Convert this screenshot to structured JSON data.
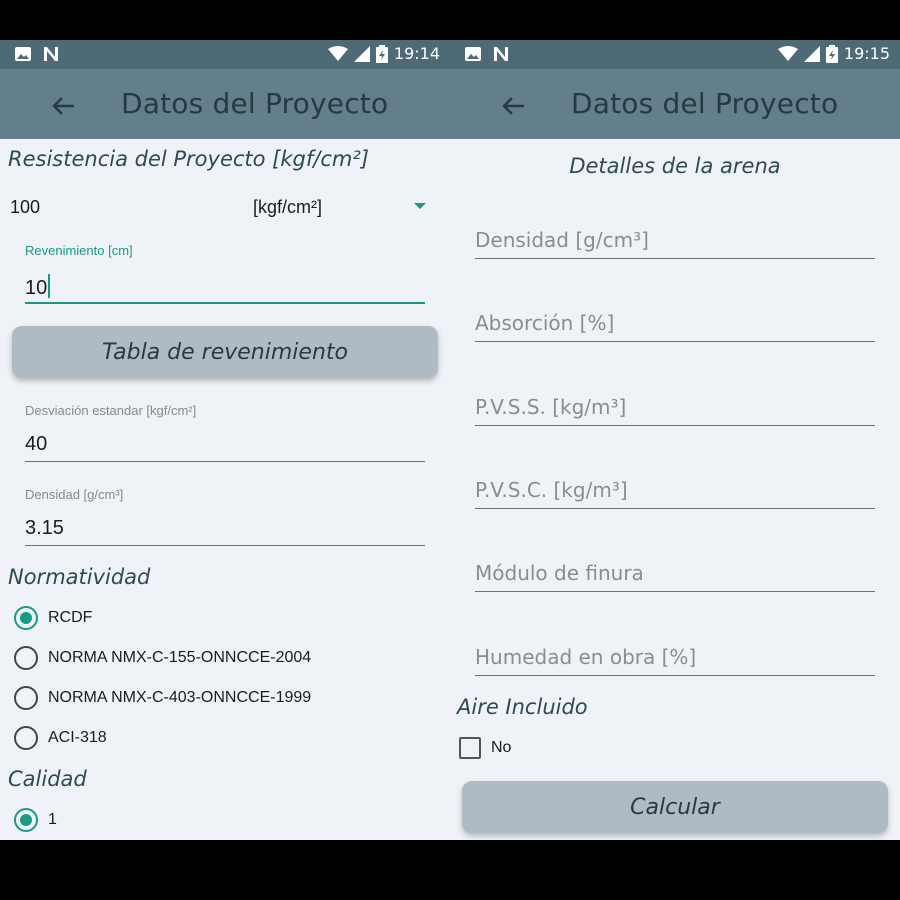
{
  "left": {
    "status_time": "19:14",
    "title": "Datos del Proyecto",
    "resistencia_heading": "Resistencia del Proyecto [kgf/cm²]",
    "resistencia_value": "100",
    "resistencia_unit": "[kgf/cm²]",
    "revenimiento_label": "Revenimiento [cm]",
    "revenimiento_value": "10",
    "tabla_button": "Tabla de revenimiento",
    "desviacion_label": "Desviación estandar [kgf/cm²]",
    "desviacion_value": "40",
    "densidad_label": "Densidad [g/cm³]",
    "densidad_value": "3.15",
    "normatividad_heading": "Normatividad",
    "normas": [
      {
        "label": "RCDF",
        "selected": true
      },
      {
        "label": "NORMA NMX-C-155-ONNCCE-2004",
        "selected": false
      },
      {
        "label": "NORMA NMX-C-403-ONNCCE-1999",
        "selected": false
      },
      {
        "label": "ACI-318",
        "selected": false
      }
    ],
    "calidad_heading": "Calidad",
    "calidad_option": "1"
  },
  "right": {
    "status_time": "19:15",
    "title": "Datos del Proyecto",
    "arena_heading": "Detalles de la arena",
    "fields": [
      "Densidad [g/cm³]",
      "Absorción [%]",
      "P.V.S.S. [kg/m³]",
      "P.V.S.C. [kg/m³]",
      "Módulo de finura",
      "Humedad en obra [%]"
    ],
    "aire_heading": "Aire Incluido",
    "aire_checkbox": "No",
    "calcular_button": "Calcular"
  },
  "colors": {
    "accent": "#1a9a84",
    "appbar": "#627f8b",
    "statusbar": "#4e6a76",
    "button": "#aebbc2",
    "background": "#eff2f7"
  },
  "icons": [
    "image-icon",
    "n-notification-icon",
    "wifi-icon",
    "signal-icon",
    "battery-icon",
    "back-arrow-icon",
    "dropdown-arrow-icon"
  ]
}
